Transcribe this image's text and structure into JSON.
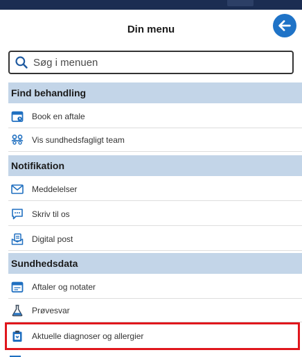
{
  "header": {
    "title": "Din menu",
    "back_icon": "arrow-left-icon"
  },
  "search": {
    "placeholder": "Søg i menuen",
    "value": "",
    "icon": "search-icon"
  },
  "sections": [
    {
      "label": "Find behandling",
      "items": [
        {
          "label": "Book en aftale",
          "icon": "calendar-icon"
        },
        {
          "label": "Vis sundhedsfagligt team",
          "icon": "team-icon"
        }
      ]
    },
    {
      "label": "Notifikation",
      "items": [
        {
          "label": "Meddelelser",
          "icon": "mail-icon"
        },
        {
          "label": "Skriv til os",
          "icon": "chat-icon"
        },
        {
          "label": "Digital post",
          "icon": "digital-post-icon"
        }
      ]
    },
    {
      "label": "Sundhedsdata",
      "items": [
        {
          "label": "Aftaler og notater",
          "icon": "calendar-notes-icon"
        },
        {
          "label": "Prøvesvar",
          "icon": "flask-icon"
        },
        {
          "label": "Aktuelle diagnoser og allergier",
          "icon": "clipboard-icon",
          "highlighted": true
        }
      ]
    }
  ],
  "colors": {
    "top_strip": "#1b2d52",
    "accent": "#1f73c7",
    "section_bg": "#c3d5e8",
    "highlight": "#e0161c"
  }
}
